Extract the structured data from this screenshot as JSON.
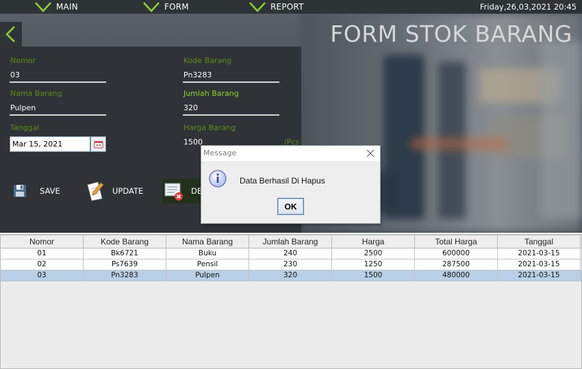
{
  "nav": {
    "items": [
      {
        "label": "MAIN"
      },
      {
        "label": "FORM"
      },
      {
        "label": "REPORT"
      }
    ],
    "datetime": "Friday,26,03,2021 20:45"
  },
  "header": {
    "title": "FORM STOK BARANG"
  },
  "form": {
    "nomor_label": "Nomor",
    "nomor_value": "03",
    "kode_label": "Kode Barang",
    "kode_value": "Pn3283",
    "nama_label": "Nama Barang",
    "nama_value": "Pulpen",
    "jumlah_label": "Jumlah Barang",
    "jumlah_value": "320",
    "tanggal_label": "Tanggal",
    "tanggal_value": "Mar 15, 2021",
    "harga_label": "Harga Barang",
    "harga_value": "1500",
    "harga_unit": "/Pcs"
  },
  "actions": {
    "save_label": "SAVE",
    "update_label": "UPDATE",
    "delete_label": "DE"
  },
  "table": {
    "columns": [
      "Nomor",
      "Kode Barang",
      "Nama Barang",
      "Jumlah Barang",
      "Harga",
      "Total Harga",
      "Tanggal"
    ],
    "rows": [
      [
        "01",
        "Bk6721",
        "Buku",
        "240",
        "2500",
        "600000",
        "2021-03-15"
      ],
      [
        "02",
        "Ps7639",
        "Pensil",
        "230",
        "1250",
        "287500",
        "2021-03-15"
      ],
      [
        "03",
        "Pn3283",
        "Pulpen",
        "320",
        "1500",
        "480000",
        "2021-03-15"
      ]
    ],
    "selected_row": 2
  },
  "dialog": {
    "title": "Message",
    "message": "Data Berhasil Di Hapus",
    "ok_label": "OK"
  },
  "colors": {
    "accent_green": "#8fd42e",
    "label_green": "#5d8a1a",
    "panel_dark": "#2f3337",
    "selection_blue": "#b8cfe5"
  }
}
